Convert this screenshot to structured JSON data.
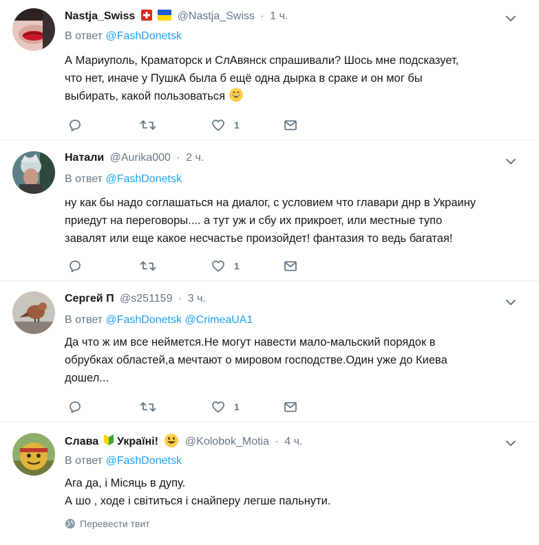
{
  "colors": {
    "link": "#1da1f2",
    "muted": "#657786",
    "text": "#14171a",
    "divider": "#e6ecf0"
  },
  "tweets": [
    {
      "name": "Nastja_Swiss",
      "handle": "@Nastja_Swiss",
      "time": "1 ч.",
      "reply_prefix": "В ответ",
      "reply_to": [
        "@FashDonetsk"
      ],
      "lines": [
        "А Мариуполь, Краматорск и СлАвянск спрашивали? Шось мне подсказует,",
        "что нет, иначе у ПушкА была б ещё одна дырка в сраке и он мог бы",
        "выбирать, какой пользоваться"
      ],
      "likes": "1",
      "flags": [
        "swiss-flag",
        "ukraine-flag"
      ],
      "trailing_emoji": "grinning-face-emoji"
    },
    {
      "name": "Натали",
      "handle": "@Aurika000",
      "time": "2 ч.",
      "reply_prefix": "В ответ",
      "reply_to": [
        "@FashDonetsk"
      ],
      "lines": [
        "ну как бы надо соглашаться на диалог, с условием что главари днр в Украину",
        "приедут на переговоры.... а тут уж и сбу их прикроет, или местные тупо",
        "завалят или еще какое несчастье произойдет! фантазия то ведь багатая!"
      ],
      "likes": "1"
    },
    {
      "name": "Сергей П",
      "handle": "@s251159",
      "time": "3 ч.",
      "reply_prefix": "В ответ",
      "reply_to": [
        "@FashDonetsk",
        "@CrimeaUA1"
      ],
      "lines": [
        "Да что ж им все неймется.Не могут навести мало-мальский порядок в",
        "обрубках областей,а мечтают о мировом господстве.Один уже до Киева",
        "дошел..."
      ],
      "likes": "1"
    },
    {
      "name_part1": "Слава",
      "name_part2": "Україні!",
      "handle": "@Kolobok_Motia",
      "time": "4 ч.",
      "reply_prefix": "В ответ",
      "reply_to": [
        "@FashDonetsk"
      ],
      "lines": [
        "Ага да, і Місяць в дупу.",
        "А шо , ходе і світиться і снайперу легше пальнути."
      ],
      "translate_label": "Перевести твит",
      "name_icons": [
        "beginner-symbol-icon",
        "smiley-emoji"
      ]
    }
  ]
}
